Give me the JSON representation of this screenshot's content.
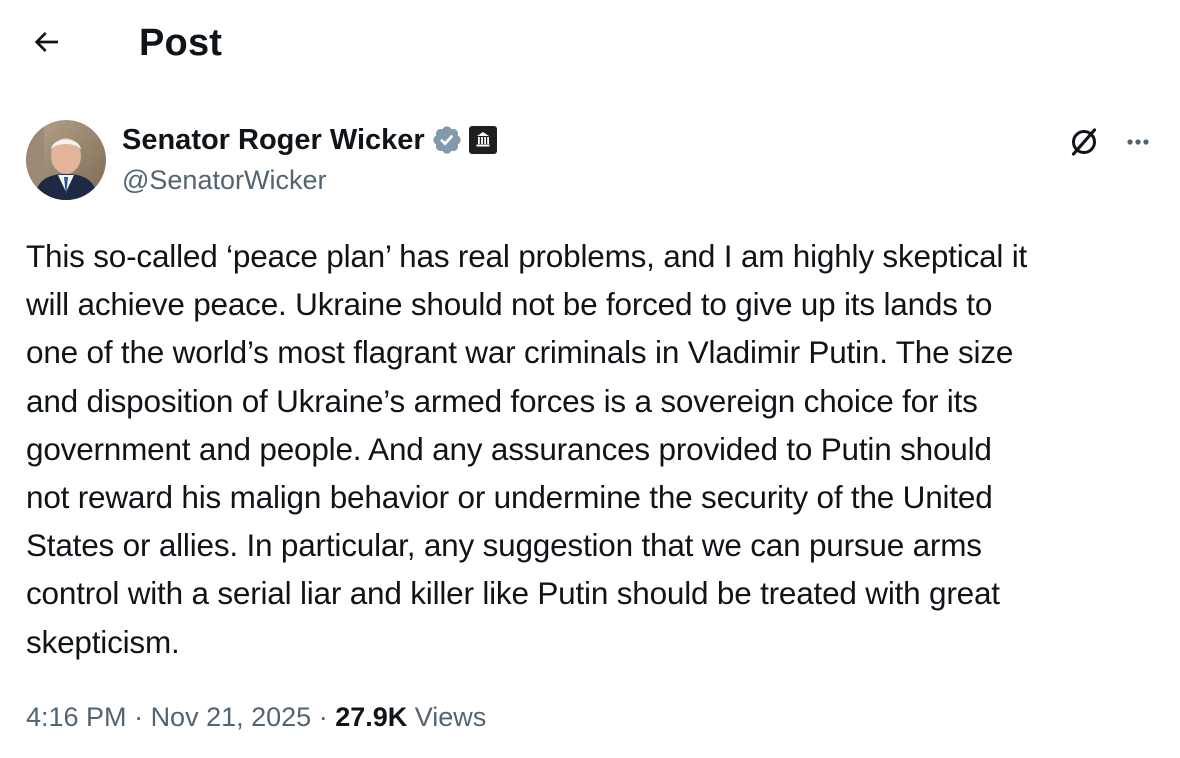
{
  "header": {
    "back_icon": "arrow-left-icon",
    "title": "Post"
  },
  "author": {
    "display_name": "Senator Roger Wicker",
    "handle": "@SenatorWicker",
    "verified_icon": "verified-badge-icon",
    "verified_color": "#829aab",
    "affiliation_icon": "government-building-icon"
  },
  "actions": {
    "grok_icon": "grok-icon",
    "more_icon": "more-horizontal-icon"
  },
  "post": {
    "text": "This so-called ‘peace plan’ has real problems, and I am highly skeptical it\nwill achieve peace. Ukraine should not be forced to give up its lands to\none of the world’s most flagrant war criminals in Vladimir Putin. The size\nand disposition of Ukraine’s armed forces is a sovereign choice for its\ngovernment and people. And any assurances provided to Putin should\nnot reward his malign behavior or undermine the security of the United\nStates or allies. In particular, any suggestion that we can pursue arms\ncontrol with a serial liar and killer like Putin should be treated with great\nskepticism."
  },
  "meta": {
    "time": "4:16 PM",
    "separator": " · ",
    "date": "Nov 21, 2025",
    "views_count": "27.9K",
    "views_label": " Views"
  },
  "colors": {
    "text_primary": "#0f1419",
    "text_secondary": "#536471",
    "background": "#ffffff"
  }
}
